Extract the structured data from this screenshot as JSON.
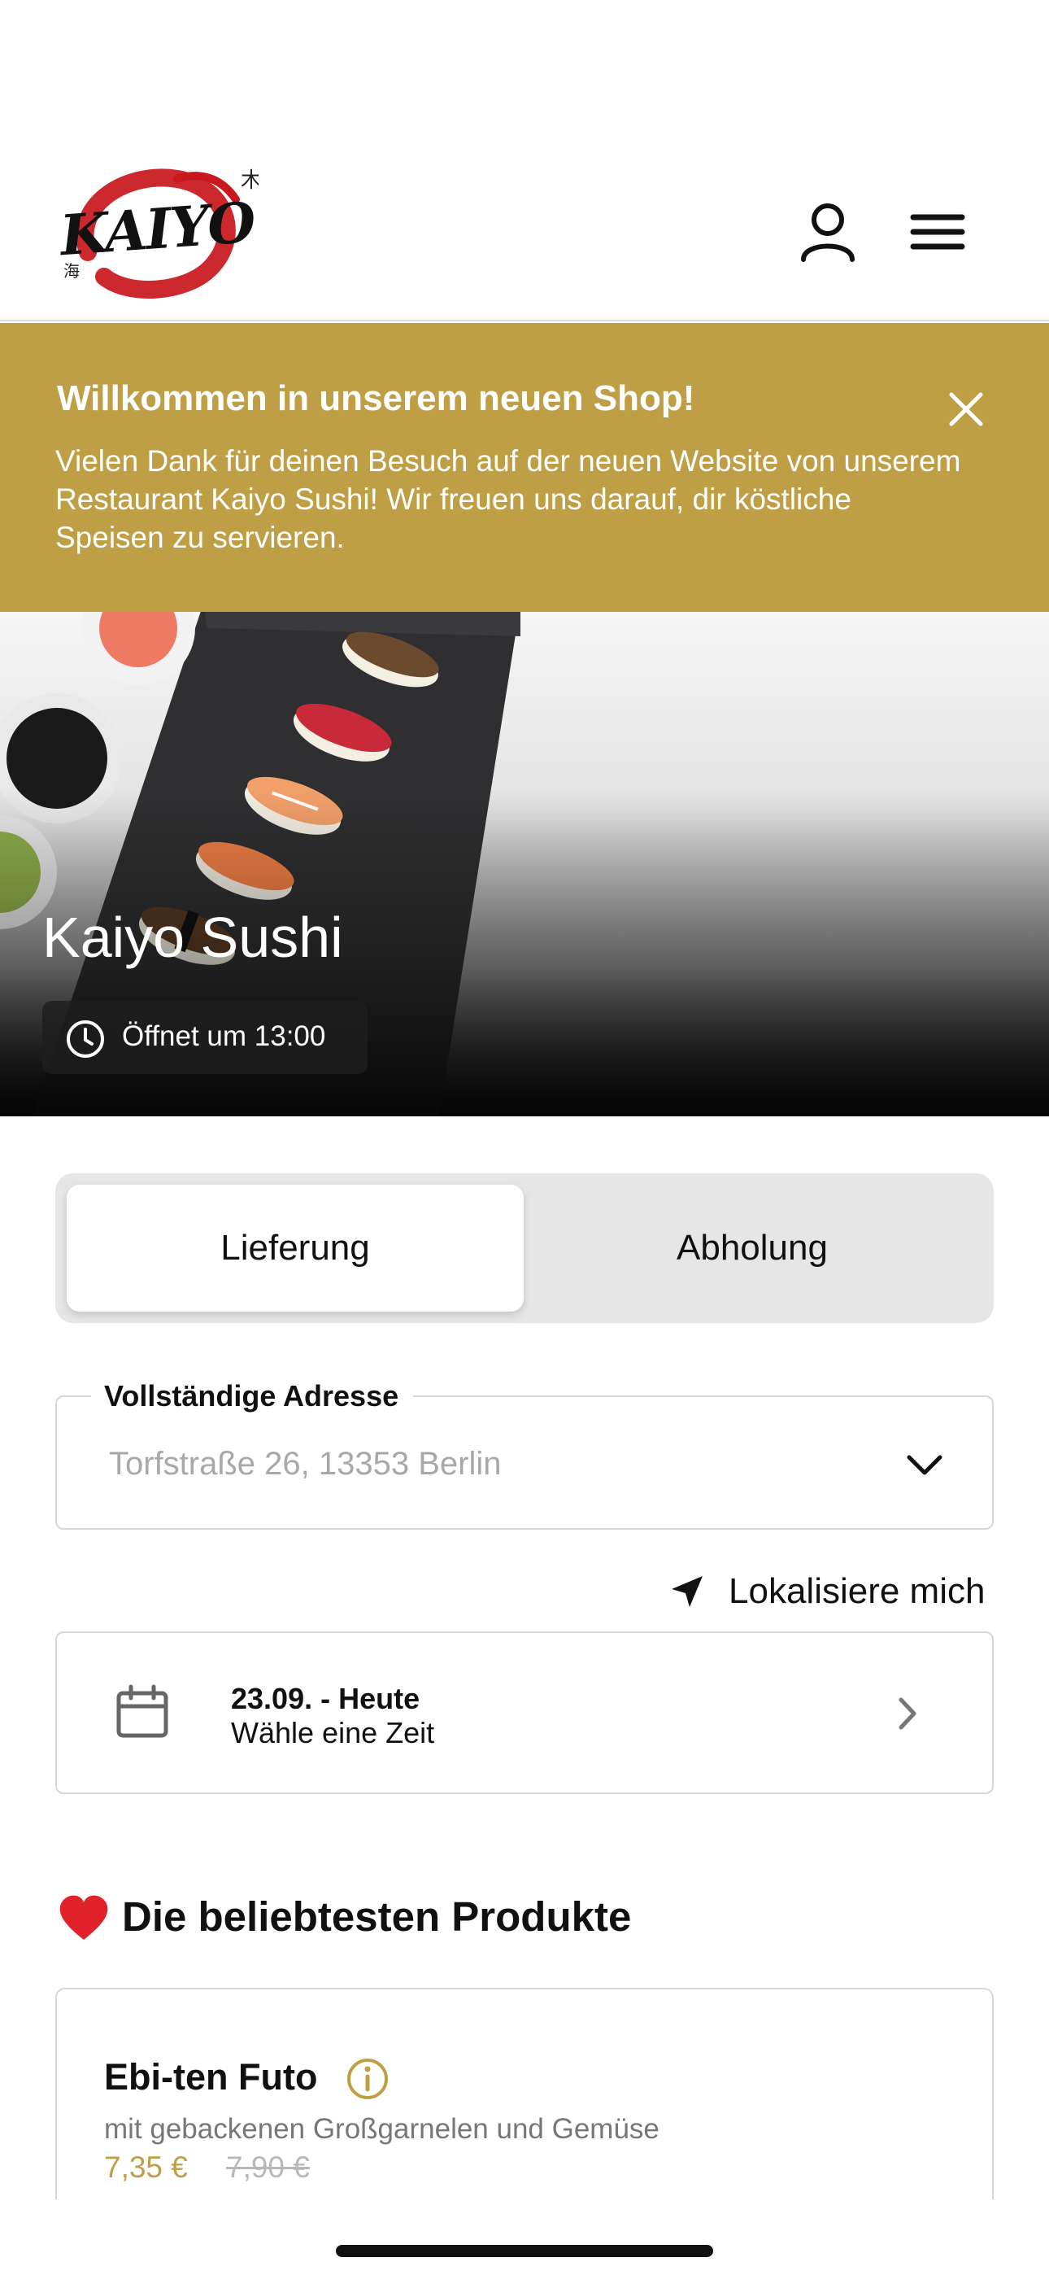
{
  "header": {
    "logo_text": "KAIYO",
    "icons": {
      "account": "user-icon",
      "menu": "hamburger-menu-icon"
    }
  },
  "banner": {
    "title": "Willkommen in unserem neuen Shop!",
    "text": "Vielen Dank für deinen Besuch auf der neuen Website von unserem Restaurant Kaiyo Sushi! Wir freuen uns darauf, dir köstliche Speisen zu servieren.",
    "background_color": "#bf9f45"
  },
  "hero": {
    "restaurant_name": "Kaiyo Sushi",
    "opening_status": "Öffnet um 13:00"
  },
  "order_mode": {
    "options": [
      "Lieferung",
      "Abholung"
    ],
    "selected": "Lieferung"
  },
  "address": {
    "label": "Vollständige Adresse",
    "placeholder": "Torfstraße 26, 13353 Berlin"
  },
  "locate": {
    "label": "Lokalisiere mich"
  },
  "date_picker": {
    "title": "23.09. - Heute",
    "subtitle": "Wähle eine Zeit"
  },
  "popular": {
    "title": "Die beliebtesten Produkte",
    "products": [
      {
        "name": "Ebi-ten Futo",
        "description": "mit gebackenen Großgarnelen und Gemüse",
        "price": "7,35 €",
        "old_price": "7,90 €"
      }
    ]
  },
  "colors": {
    "accent": "#bf9f45",
    "text": "#111111"
  }
}
